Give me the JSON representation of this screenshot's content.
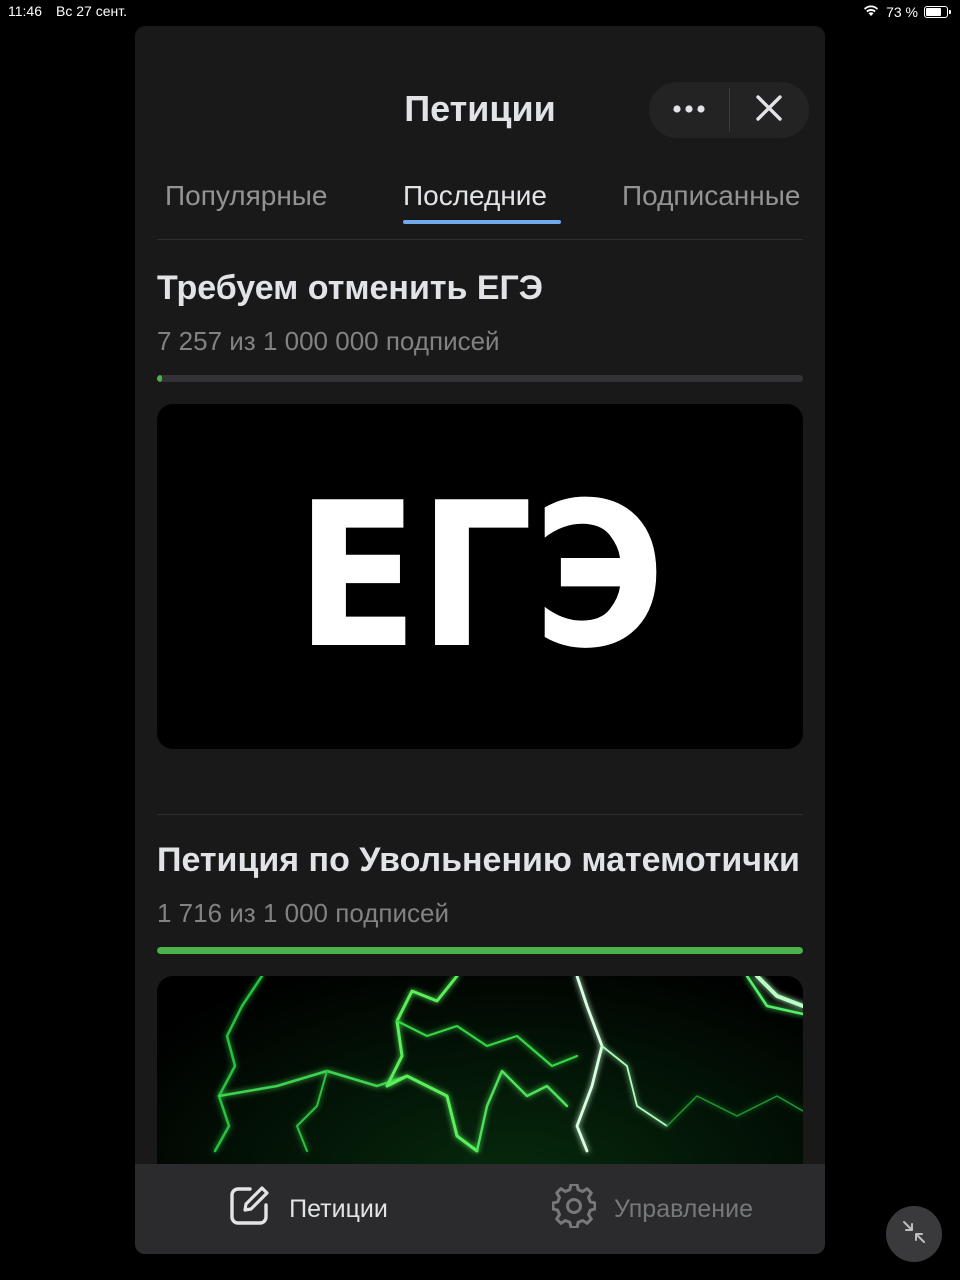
{
  "status_bar": {
    "time": "11:46",
    "date": "Вс 27 сент.",
    "battery": "73 %",
    "battery_level": 0.73
  },
  "header": {
    "title": "Петиции",
    "more_icon": "more-horizontal-icon",
    "close_icon": "close-icon"
  },
  "tabs": [
    {
      "label": "Популярные",
      "active": false
    },
    {
      "label": "Последние",
      "active": true
    },
    {
      "label": "Подписанные",
      "active": false
    }
  ],
  "petitions": [
    {
      "title": "Требуем отменить ЕГЭ",
      "count": "7 257 из 1 000 000 подписей",
      "progress": 0.007257,
      "image_text": "ЕГЭ"
    },
    {
      "title": "Петиция по Увольнению матемотички",
      "count": "1 716 из 1 000 подписей",
      "progress": 1.0,
      "image_description_icon": "lightning-image"
    }
  ],
  "tabbar": [
    {
      "label": "Петиции",
      "icon": "edit-icon",
      "active": true
    },
    {
      "label": "Управление",
      "icon": "gear-icon",
      "active": false
    }
  ],
  "colors": {
    "accent": "#71aaeb",
    "progress_green": "#4bb34b",
    "panel_bg": "#19191a"
  }
}
